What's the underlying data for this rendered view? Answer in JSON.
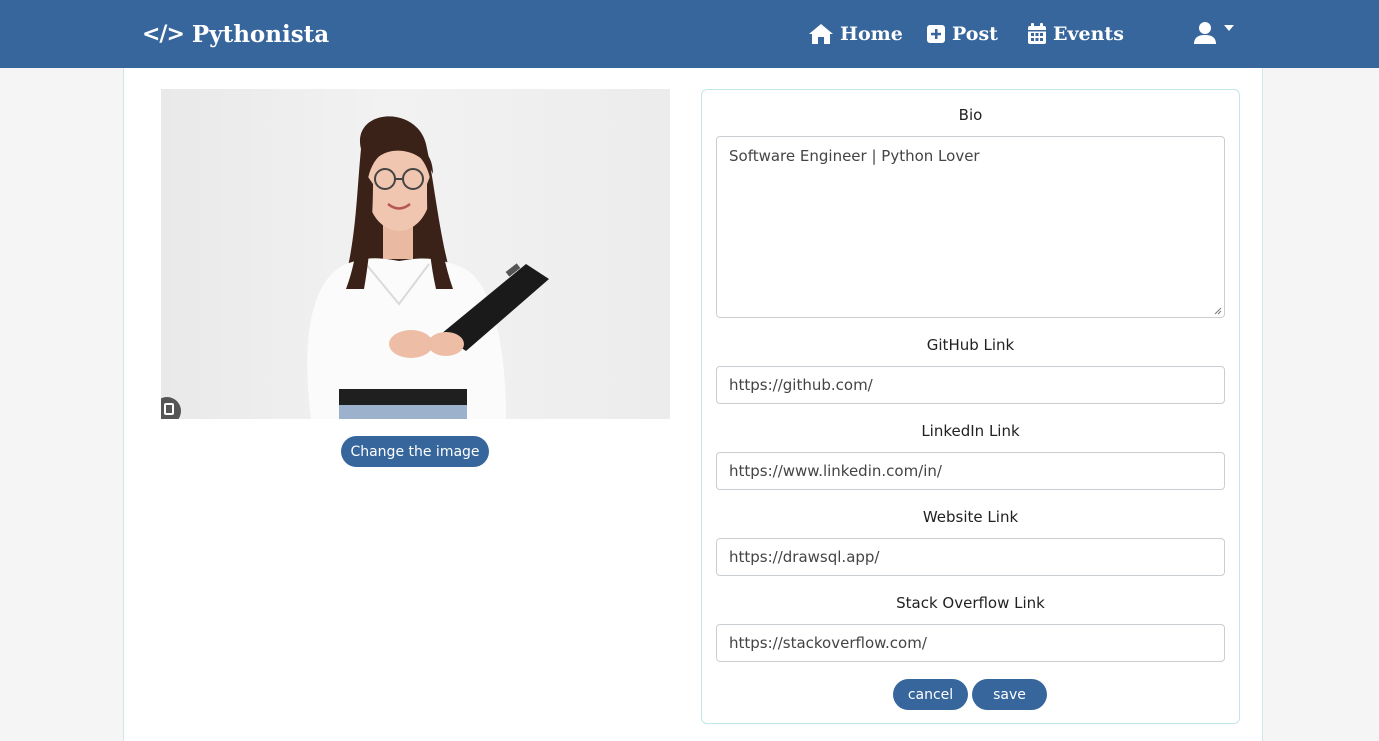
{
  "navbar": {
    "brand_icon": "</>",
    "brand_name": "Pythonista",
    "items": [
      {
        "label": "Home",
        "icon": "home-icon"
      },
      {
        "label": "Post",
        "icon": "plus-square-icon"
      },
      {
        "label": "Events",
        "icon": "calendar-icon"
      }
    ],
    "user_icon": "user-icon",
    "dropdown_icon": "caret-down-icon",
    "color": "#36669c"
  },
  "profile": {
    "change_image_label": "Change the image"
  },
  "form": {
    "bio_label": "Bio",
    "bio_value": "Software Engineer | Python Lover",
    "github_label": "GitHub Link",
    "github_value": "https://github.com/",
    "linkedin_label": "LinkedIn Link",
    "linkedin_value": "https://www.linkedin.com/in/",
    "website_label": "Website Link",
    "website_value": "https://drawsql.app/",
    "stackoverflow_label": "Stack Overflow Link",
    "stackoverflow_value": "https://stackoverflow.com/",
    "cancel_label": "cancel",
    "save_label": "save"
  }
}
